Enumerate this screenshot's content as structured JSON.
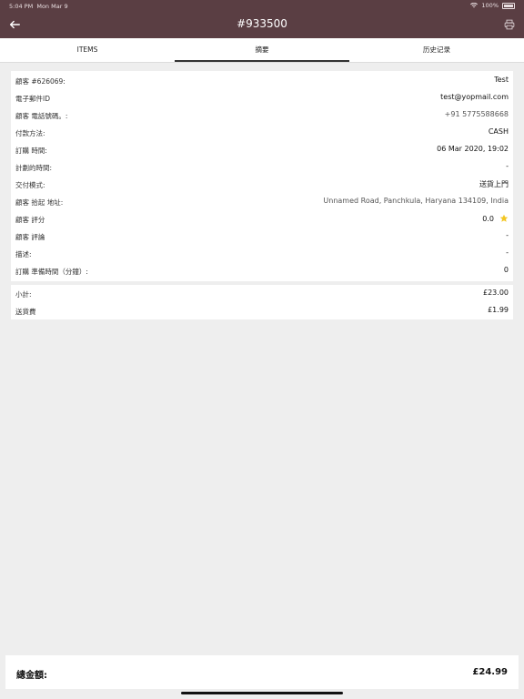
{
  "status_bar": {
    "time": "5:04 PM",
    "date": "Mon Mar 9",
    "battery": "100%"
  },
  "header": {
    "title": "#933500"
  },
  "tabs": [
    {
      "label": "ITEMS",
      "active": false
    },
    {
      "label": "摘要",
      "active": true
    },
    {
      "label": "历史记录",
      "active": false
    }
  ],
  "details": [
    {
      "label": "顧客 #626069:",
      "value": "Test"
    },
    {
      "label": "電子郵件ID",
      "value": "test@yopmail.com"
    },
    {
      "label": "顧客 電話號碼。:",
      "value": "+91 5775588668"
    },
    {
      "label": "付款方法:",
      "value": "CASH"
    },
    {
      "label": "訂購 時間:",
      "value": "06 Mar 2020, 19:02"
    },
    {
      "label": "計劃的時間:",
      "value": "-"
    },
    {
      "label": "交付模式:",
      "value": "送貨上門"
    },
    {
      "label": "顧客 拾起 地址:",
      "value": "Unnamed Road, Panchkula, Haryana 134109, India"
    },
    {
      "label": "顧客 評分",
      "value": "0.0"
    },
    {
      "label": "顧客 評論",
      "value": "-"
    },
    {
      "label": "描述:",
      "value": "-"
    },
    {
      "label": "訂購 準備時間（分鐘）:",
      "value": "0"
    }
  ],
  "totals": [
    {
      "label": "小計:",
      "value": "£23.00"
    },
    {
      "label": "送貨費",
      "value": "£1.99"
    }
  ],
  "footer": {
    "label": "總金額:",
    "value": "£24.99"
  },
  "colors": {
    "header": "#5a3e43",
    "star": "#f3c623"
  }
}
